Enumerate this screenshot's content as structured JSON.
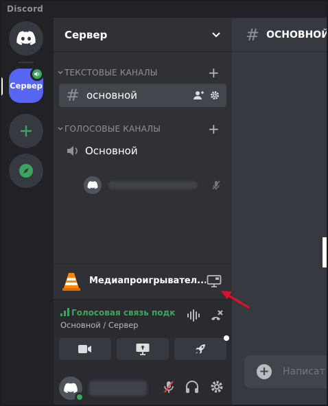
{
  "app": {
    "title": "Discord"
  },
  "guilds": {
    "server_label": "Сервер"
  },
  "sidebar": {
    "server_name": "Сервер",
    "categories": {
      "text": "ТЕКСТОВЫЕ КАНАЛЫ",
      "voice": "ГОЛОСОВЫЕ КАНАЛЫ"
    },
    "text_channel": "основной",
    "voice_channel": "Основной"
  },
  "activity": {
    "title": "Медиапроигрывател..."
  },
  "voice": {
    "status": "Голосовая связь подк",
    "channel": "Основной / Сервер"
  },
  "main": {
    "channel": "ОСНОВНОЙ",
    "composer_placeholder": "Написат"
  },
  "colors": {
    "brand": "#5865f2",
    "online": "#3ba55d",
    "arrow": "#e0102a"
  }
}
